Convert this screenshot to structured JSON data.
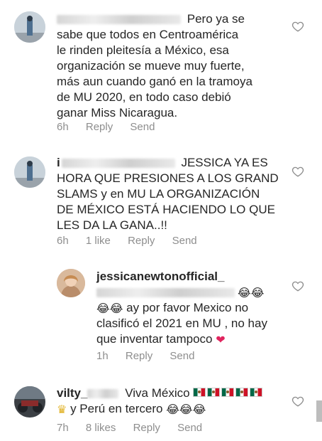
{
  "comments": [
    {
      "username": "",
      "lines": [
        "Pero ya se",
        "sabe que todos en Centroamérica",
        "le rinden pleitesía a México, esa",
        "organización se mueve muy fuerte,",
        "más aun cuando ganó en la tramoya",
        "de MU 2020, en todo caso debió",
        "ganar Miss Nicaragua."
      ],
      "time": "6h",
      "reply_label": "Reply",
      "send_label": "Send"
    },
    {
      "username_visible": "i",
      "lines": [
        "JESSICA YA ES",
        "HORA QUE PRESIONES A LOS GRAND",
        "SLAMS y en MU LA ORGANIZACIÓN",
        "DE MÉXICO ESTÁ HACIENDO LO QUE",
        "LES DA LA GANA..!!"
      ],
      "time": "6h",
      "likes": "1 like",
      "reply_label": "Reply",
      "send_label": "Send"
    },
    {
      "username": "jessicanewtonofficial_",
      "lines": [
        "ay por favor Mexico no",
        "clasificó el 2021 en MU , no hay",
        "que inventar tampoco"
      ],
      "time": "1h",
      "reply_label": "Reply",
      "send_label": "Send"
    },
    {
      "username_visible": "vilty_",
      "lines": [
        "Viva México",
        "y Perú en tercero"
      ],
      "time": "7h",
      "likes": "8 likes",
      "reply_label": "Reply",
      "send_label": "Send"
    }
  ],
  "icons": {
    "like": "heart-outline-icon",
    "laugh": "laughing-tears-emoji",
    "crown": "crown-emoji",
    "heart_red": "red-heart-emoji",
    "flag": "mexico-flag-emoji"
  },
  "colors": {
    "text": "#262626",
    "meta": "#8e8e8e",
    "red_heart": "#e0245e"
  }
}
